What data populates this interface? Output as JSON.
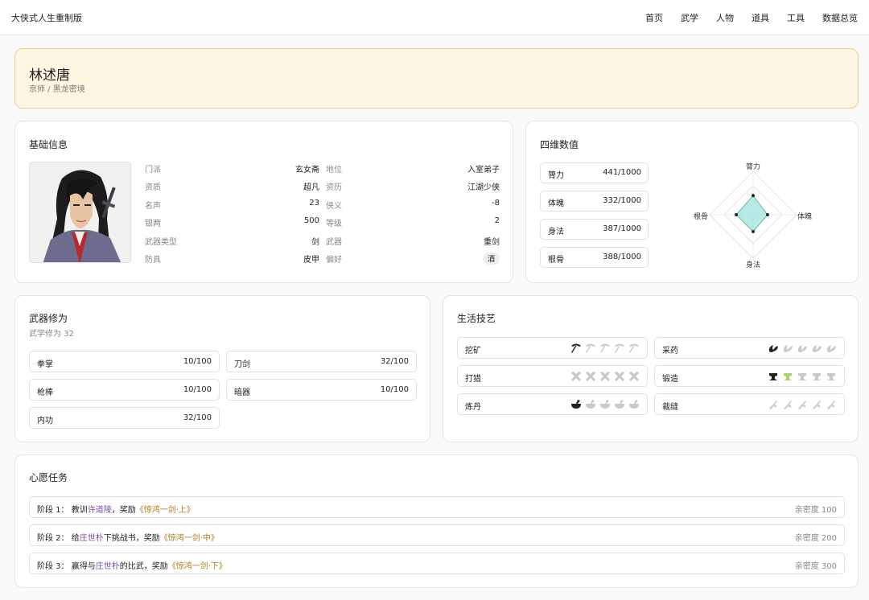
{
  "app": {
    "title": "大侠式人生重制版",
    "nav": [
      "首页",
      "武学",
      "人物",
      "道具",
      "工具",
      "数据总览"
    ]
  },
  "hero": {
    "name": "林述唐",
    "location": "京师 / 黑龙密境"
  },
  "basic": {
    "title": "基础信息",
    "fields": [
      {
        "label": "门派",
        "value": "玄女斋"
      },
      {
        "label": "地位",
        "value": "入室弟子"
      },
      {
        "label": "资质",
        "value": "超凡"
      },
      {
        "label": "资历",
        "value": "江湖少侠"
      },
      {
        "label": "名声",
        "value": "23"
      },
      {
        "label": "侠义",
        "value": "-8"
      },
      {
        "label": "银两",
        "value": "500"
      },
      {
        "label": "等级",
        "value": "2"
      },
      {
        "label": "武器类型",
        "value": "剑"
      },
      {
        "label": "武器",
        "value": "重剑"
      },
      {
        "label": "防具",
        "value": "皮甲"
      },
      {
        "label": "偏好",
        "value": "酒"
      }
    ]
  },
  "stats": {
    "title": "四维数值",
    "max": 1000,
    "items": [
      {
        "label": "膂力",
        "value": "441/1000",
        "num": 441
      },
      {
        "label": "体魄",
        "value": "332/1000",
        "num": 332
      },
      {
        "label": "身法",
        "value": "387/1000",
        "num": 387
      },
      {
        "label": "根骨",
        "value": "388/1000",
        "num": 388
      }
    ],
    "radar_labels": {
      "top": "膂力",
      "right": "体魄",
      "bottom": "身法",
      "left": "根骨"
    }
  },
  "weapons": {
    "title": "武器修为",
    "subtitle": "武学修为 32",
    "items": [
      {
        "label": "拳掌",
        "value": "10/100"
      },
      {
        "label": "刀剑",
        "value": "32/100"
      },
      {
        "label": "枪棒",
        "value": "10/100"
      },
      {
        "label": "暗器",
        "value": "10/100"
      },
      {
        "label": "内功",
        "value": "32/100"
      }
    ]
  },
  "skills": {
    "title": "生活技艺",
    "items": [
      {
        "label": "挖矿",
        "icon": "pickaxe-icon",
        "level": 1
      },
      {
        "label": "采药",
        "icon": "herb-icon",
        "level": 1
      },
      {
        "label": "打猎",
        "icon": "crossed-arrows-icon",
        "level": 0
      },
      {
        "label": "锻造",
        "icon": "anvil-icon",
        "level": 2
      },
      {
        "label": "炼丹",
        "icon": "mortar-icon",
        "level": 1
      },
      {
        "label": "裁缝",
        "icon": "needle-icon",
        "level": 0
      }
    ],
    "accent_active": "#222222",
    "accent_inactive": "#c9c9c9",
    "accent_green": "#a6d66a"
  },
  "quests": {
    "title": "心愿任务",
    "items": [
      {
        "stage": "阶段 1：",
        "pre": "教训",
        "npc": "许道陵",
        "mid": "，奖励",
        "reward": "《惊鸿一剑·上》",
        "affinity": "亲密度 100"
      },
      {
        "stage": "阶段 2：",
        "pre": "给",
        "npc": "庄世朴",
        "mid": "下挑战书，奖励",
        "reward": "《惊鸿一剑·中》",
        "affinity": "亲密度 200"
      },
      {
        "stage": "阶段 3：",
        "pre": "赢得与",
        "npc": "庄世朴",
        "mid": "的比武，奖励",
        "reward": "《惊鸿一剑·下》",
        "affinity": "亲密度 300"
      }
    ]
  }
}
